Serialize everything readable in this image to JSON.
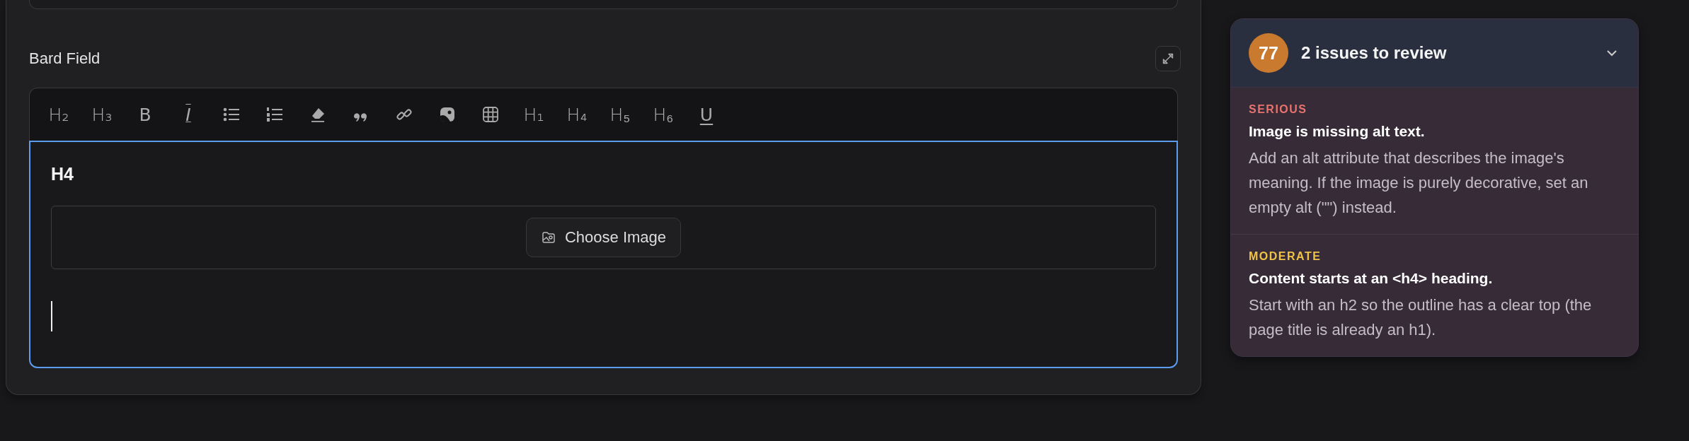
{
  "field": {
    "label": "Bard Field"
  },
  "toolbar": [
    {
      "kind": "heading",
      "label": "H₂"
    },
    {
      "kind": "heading",
      "label": "H₃"
    },
    {
      "kind": "bold",
      "label": "B"
    },
    {
      "kind": "italic",
      "label": "I"
    },
    {
      "kind": "icon"
    },
    {
      "kind": "icon"
    },
    {
      "kind": "icon"
    },
    {
      "kind": "icon"
    },
    {
      "kind": "icon"
    },
    {
      "kind": "icon"
    },
    {
      "kind": "icon"
    },
    {
      "kind": "heading",
      "label": "H₁"
    },
    {
      "kind": "heading",
      "label": "H₄"
    },
    {
      "kind": "heading",
      "label": "H₅"
    },
    {
      "kind": "heading",
      "label": "H₆"
    },
    {
      "kind": "underline",
      "label": "U"
    }
  ],
  "editor": {
    "focused": true,
    "heading": "H4",
    "image_button": "Choose Image"
  },
  "review": {
    "score": "77",
    "title": "2 issues to review",
    "expanded": true,
    "issues": [
      {
        "severity": "SERIOUS",
        "color": "#e8736e",
        "title": "Image is missing alt text.",
        "description": "Add an alt attribute that describes the image's meaning. If the image is purely decorative, set an empty alt (\"\") instead."
      },
      {
        "severity": "MODERATE",
        "color": "#f0c246",
        "title": "Content starts at an <h4> heading.",
        "description": "Start with an h2 so the outline has a clear top (the page title is already an h1)."
      }
    ]
  }
}
